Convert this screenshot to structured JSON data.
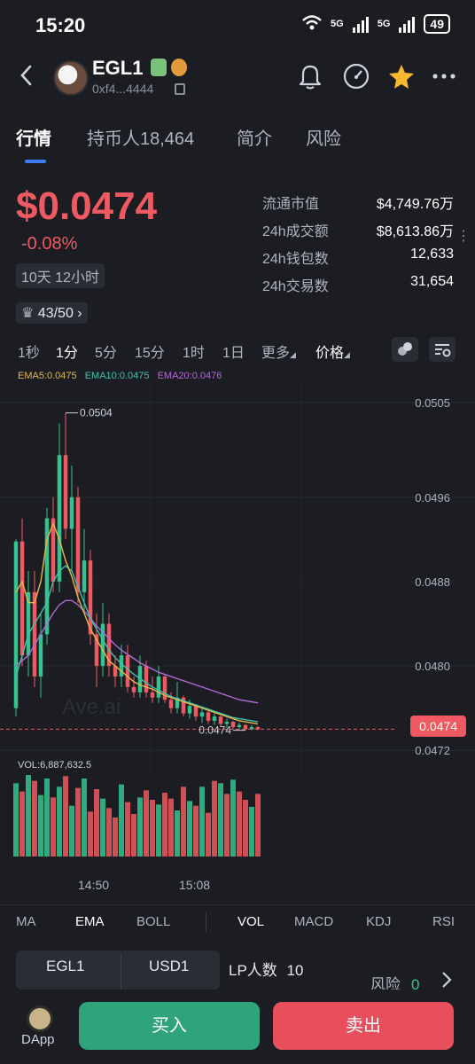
{
  "status_bar": {
    "time": "15:20",
    "network_1": "5G",
    "network_2": "5G",
    "battery": "49"
  },
  "header": {
    "token_name": "EGL1",
    "address": "0xf4...4444",
    "icons": [
      "back-icon",
      "bell-icon",
      "gauge-icon",
      "star-icon",
      "more-icon"
    ],
    "star_color": "#f5b82e"
  },
  "tabs": [
    {
      "label": "行情",
      "active": true
    },
    {
      "label": "持币人18,464",
      "active": false
    },
    {
      "label": "简介",
      "active": false
    },
    {
      "label": "风险",
      "active": false
    }
  ],
  "price": {
    "value": "$0.0474",
    "change": "-0.08%",
    "age": "10天 12小时",
    "rank": "43/50"
  },
  "stats": [
    {
      "label": "流通市值",
      "value": "$4,749.76万"
    },
    {
      "label": "24h成交额",
      "value": "$8,613.86万"
    },
    {
      "label": "24h钱包数",
      "value": "12,633"
    },
    {
      "label": "24h交易数",
      "value": "31,654"
    }
  ],
  "intervals": [
    "1秒",
    "1分",
    "5分",
    "15分",
    "1时",
    "1日",
    "更多",
    "价格"
  ],
  "active_interval": "1分",
  "chart_legend": {
    "ema5": "EMA5:0.0475",
    "ema10": "EMA10:0.0475",
    "ema20": "EMA20:0.0476"
  },
  "chart_data": {
    "type": "candlestick",
    "y_ticks": [
      "0.0505",
      "0.0496",
      "0.0488",
      "0.0480",
      "0.0472"
    ],
    "ylim": [
      0.047,
      0.0507
    ],
    "high_marker": "0.0504",
    "low_marker": "0.0474",
    "current_price": "0.0474",
    "x_labels": [
      "14:50",
      "15:08"
    ],
    "watermark": "Ave.ai",
    "up_color": "#34c38f",
    "down_color": "#ef5a62",
    "ema_colors": {
      "ema5": "#e6b84a",
      "ema10": "#3ec3a8",
      "ema20": "#b36ad9"
    },
    "candles": [
      {
        "o": 0.0476,
        "h": 0.0492,
        "l": 0.04752,
        "c": 0.04918
      },
      {
        "o": 0.04918,
        "h": 0.0494,
        "l": 0.048,
        "c": 0.0481
      },
      {
        "o": 0.0481,
        "h": 0.0489,
        "l": 0.0479,
        "c": 0.0487
      },
      {
        "o": 0.0487,
        "h": 0.0489,
        "l": 0.0478,
        "c": 0.0479
      },
      {
        "o": 0.0479,
        "h": 0.0485,
        "l": 0.0477,
        "c": 0.0483
      },
      {
        "o": 0.0483,
        "h": 0.0495,
        "l": 0.0482,
        "c": 0.0494
      },
      {
        "o": 0.0494,
        "h": 0.0496,
        "l": 0.0487,
        "c": 0.0488
      },
      {
        "o": 0.0488,
        "h": 0.0503,
        "l": 0.0487,
        "c": 0.05
      },
      {
        "o": 0.05,
        "h": 0.0504,
        "l": 0.0492,
        "c": 0.0493
      },
      {
        "o": 0.0493,
        "h": 0.0499,
        "l": 0.0489,
        "c": 0.0496
      },
      {
        "o": 0.0496,
        "h": 0.0497,
        "l": 0.0486,
        "c": 0.0487
      },
      {
        "o": 0.0487,
        "h": 0.0493,
        "l": 0.0485,
        "c": 0.049
      },
      {
        "o": 0.049,
        "h": 0.0491,
        "l": 0.0482,
        "c": 0.0483
      },
      {
        "o": 0.0483,
        "h": 0.0485,
        "l": 0.0478,
        "c": 0.048
      },
      {
        "o": 0.048,
        "h": 0.0486,
        "l": 0.0479,
        "c": 0.0484
      },
      {
        "o": 0.0484,
        "h": 0.0485,
        "l": 0.0479,
        "c": 0.048
      },
      {
        "o": 0.048,
        "h": 0.0481,
        "l": 0.0478,
        "c": 0.0479
      },
      {
        "o": 0.0479,
        "h": 0.0482,
        "l": 0.0478,
        "c": 0.0481
      },
      {
        "o": 0.0481,
        "h": 0.0482,
        "l": 0.04775,
        "c": 0.0478
      },
      {
        "o": 0.0478,
        "h": 0.0479,
        "l": 0.0477,
        "c": 0.04775
      },
      {
        "o": 0.04775,
        "h": 0.0481,
        "l": 0.0477,
        "c": 0.048
      },
      {
        "o": 0.048,
        "h": 0.04805,
        "l": 0.0477,
        "c": 0.04775
      },
      {
        "o": 0.04775,
        "h": 0.0479,
        "l": 0.04765,
        "c": 0.0477
      },
      {
        "o": 0.0477,
        "h": 0.048,
        "l": 0.04765,
        "c": 0.0479
      },
      {
        "o": 0.0479,
        "h": 0.04792,
        "l": 0.04765,
        "c": 0.04768
      },
      {
        "o": 0.04768,
        "h": 0.04775,
        "l": 0.04755,
        "c": 0.0476
      },
      {
        "o": 0.0476,
        "h": 0.04785,
        "l": 0.04755,
        "c": 0.0477
      },
      {
        "o": 0.0477,
        "h": 0.04772,
        "l": 0.04752,
        "c": 0.04755
      },
      {
        "o": 0.04755,
        "h": 0.04768,
        "l": 0.0475,
        "c": 0.04762
      },
      {
        "o": 0.04762,
        "h": 0.04764,
        "l": 0.04748,
        "c": 0.04752
      },
      {
        "o": 0.04752,
        "h": 0.0476,
        "l": 0.04746,
        "c": 0.04756
      },
      {
        "o": 0.04756,
        "h": 0.04758,
        "l": 0.04745,
        "c": 0.04748
      },
      {
        "o": 0.04748,
        "h": 0.04755,
        "l": 0.04744,
        "c": 0.04752
      },
      {
        "o": 0.04752,
        "h": 0.04753,
        "l": 0.04742,
        "c": 0.04745
      },
      {
        "o": 0.04745,
        "h": 0.0475,
        "l": 0.04741,
        "c": 0.04747
      },
      {
        "o": 0.04747,
        "h": 0.04748,
        "l": 0.0474,
        "c": 0.04742
      },
      {
        "o": 0.04742,
        "h": 0.04746,
        "l": 0.0474,
        "c": 0.04744
      },
      {
        "o": 0.04744,
        "h": 0.04745,
        "l": 0.04739,
        "c": 0.0474
      },
      {
        "o": 0.0474,
        "h": 0.04744,
        "l": 0.04739,
        "c": 0.04742
      },
      {
        "o": 0.04742,
        "h": 0.04743,
        "l": 0.04739,
        "c": 0.0474
      }
    ],
    "ema5": [
      0.0487,
      0.0488,
      0.0486,
      0.0486,
      0.0488,
      0.0492,
      0.04935,
      0.0492,
      0.049,
      0.04885,
      0.04865,
      0.0485,
      0.04835,
      0.04825,
      0.04815,
      0.04805,
      0.048,
      0.04795,
      0.0479,
      0.04785,
      0.04782,
      0.0478,
      0.04778,
      0.04775,
      0.04772,
      0.0477,
      0.04768,
      0.04766,
      0.04764,
      0.04762,
      0.0476,
      0.04758,
      0.04756,
      0.04754,
      0.04752,
      0.0475,
      0.04748,
      0.04747,
      0.04746,
      0.04745
    ],
    "ema10": [
      0.0479,
      0.0481,
      0.0483,
      0.0484,
      0.0485,
      0.0486,
      0.0488,
      0.0489,
      0.04895,
      0.0489,
      0.04875,
      0.0486,
      0.04845,
      0.04835,
      0.04825,
      0.04815,
      0.04808,
      0.04802,
      0.04797,
      0.04792,
      0.04788,
      0.04784,
      0.0478,
      0.04777,
      0.04774,
      0.04771,
      0.04769,
      0.04767,
      0.04765,
      0.04763,
      0.04761,
      0.04759,
      0.04757,
      0.04755,
      0.04753,
      0.04751,
      0.0475,
      0.04749,
      0.04748,
      0.04747
    ],
    "ema20": [
      0.048,
      0.04805,
      0.0481,
      0.0482,
      0.0483,
      0.0484,
      0.0485,
      0.04858,
      0.04862,
      0.04862,
      0.04858,
      0.04852,
      0.04845,
      0.04838,
      0.04832,
      0.04826,
      0.0482,
      0.04815,
      0.04811,
      0.04807,
      0.04803,
      0.048,
      0.04797,
      0.04794,
      0.04792,
      0.0479,
      0.04788,
      0.04786,
      0.04784,
      0.04782,
      0.0478,
      0.04778,
      0.04776,
      0.04774,
      0.04772,
      0.0477,
      0.04768,
      0.04767,
      0.04766,
      0.04765
    ],
    "volume_label": "VOL:6,887,632.5",
    "volume_max": 6887632.5,
    "volumes": [
      6.2,
      5.5,
      6.9,
      6.4,
      5.2,
      6.6,
      5.0,
      5.9,
      6.8,
      4.3,
      5.8,
      6.6,
      3.8,
      5.7,
      4.9,
      4.1,
      3.3,
      6.1,
      4.6,
      3.6,
      5.0,
      5.6,
      4.8,
      4.4,
      5.4,
      4.9,
      3.9,
      5.9,
      4.7,
      4.3,
      5.9,
      3.7,
      6.4,
      6.2,
      5.3,
      6.5,
      5.5,
      4.8,
      4.2,
      5.3
    ],
    "volume_up": [
      true,
      false,
      true,
      false,
      true,
      true,
      false,
      true,
      false,
      true,
      false,
      true,
      false,
      false,
      true,
      false,
      false,
      true,
      false,
      false,
      true,
      false,
      false,
      true,
      false,
      false,
      true,
      false,
      true,
      false,
      true,
      false,
      false,
      true,
      false,
      true,
      false,
      false,
      true,
      false
    ]
  },
  "indicators": [
    "MA",
    "EMA",
    "BOLL",
    "VOL",
    "MACD",
    "KDJ",
    "RSI"
  ],
  "active_indicators": [
    "EMA",
    "VOL"
  ],
  "pool": {
    "token_a": "EGL1",
    "token_b": "USD1",
    "lp_label": "LP人数",
    "lp_count": "10",
    "risk_label": "风险",
    "risk_count": "0"
  },
  "bottom_bar": {
    "dapp_label": "DApp",
    "buy_label": "买入",
    "sell_label": "卖出"
  }
}
